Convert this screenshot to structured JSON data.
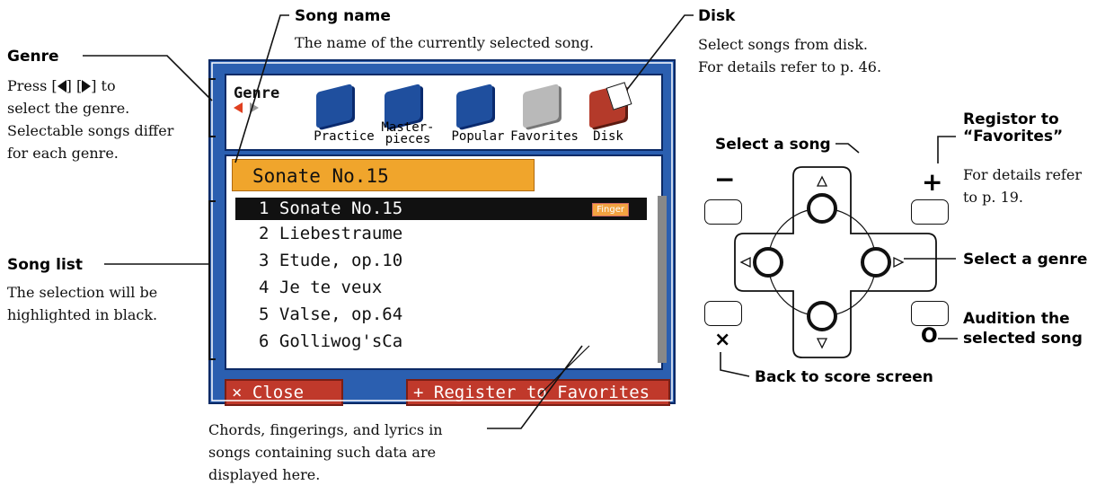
{
  "annotations": {
    "genre": {
      "title": "Genre",
      "lines": [
        "Press [",
        "] [",
        "] to",
        "select the genre.",
        "Selectable songs differ",
        "for each genre."
      ]
    },
    "song_name": {
      "title": "Song name",
      "desc": "The name of the currently selected song."
    },
    "disk": {
      "title": "Disk",
      "lines": [
        "Select songs from disk.",
        "For details refer to p. 46."
      ]
    },
    "song_list": {
      "title": "Song list",
      "lines": [
        "The selection will be",
        "highlighted in black."
      ]
    },
    "chords": {
      "lines": [
        "Chords, fingerings, and lyrics in",
        "songs containing such data are",
        "displayed here."
      ]
    },
    "select_song": "Select a song",
    "register": {
      "title_lines": [
        "Registor to",
        "“Favorites”"
      ],
      "lines": [
        "For details refer",
        "to p. 19."
      ]
    },
    "select_genre": "Select a genre",
    "audition": [
      "Audition the",
      "selected song"
    ],
    "back": "Back to score screen"
  },
  "screen": {
    "genre_label": "Genre",
    "genres": [
      {
        "label": "Practice",
        "color": "#1f4f9e"
      },
      {
        "label": "Master-\npieces",
        "color": "#1f4f9e"
      },
      {
        "label": "Popular",
        "color": "#1f4f9e"
      },
      {
        "label": "Favorites",
        "color": "#b9b9b9"
      },
      {
        "label": "Disk",
        "color": "#b43a2a"
      }
    ],
    "current_song": "Sonate No.15",
    "songs": [
      {
        "label": "1 Sonate No.15",
        "badge": "Finger",
        "selected": true
      },
      {
        "label": "2 Liebestraume"
      },
      {
        "label": "3 Etude, op.10"
      },
      {
        "label": "4 Je te veux"
      },
      {
        "label": "5 Valse, op.64"
      },
      {
        "label": "6 Golliwog'sCa"
      }
    ],
    "close_label": "× Close",
    "register_label": "+ Register to Favorites"
  },
  "controller": {
    "minus": "−",
    "plus": "+",
    "cross": "×",
    "circle": "O"
  }
}
